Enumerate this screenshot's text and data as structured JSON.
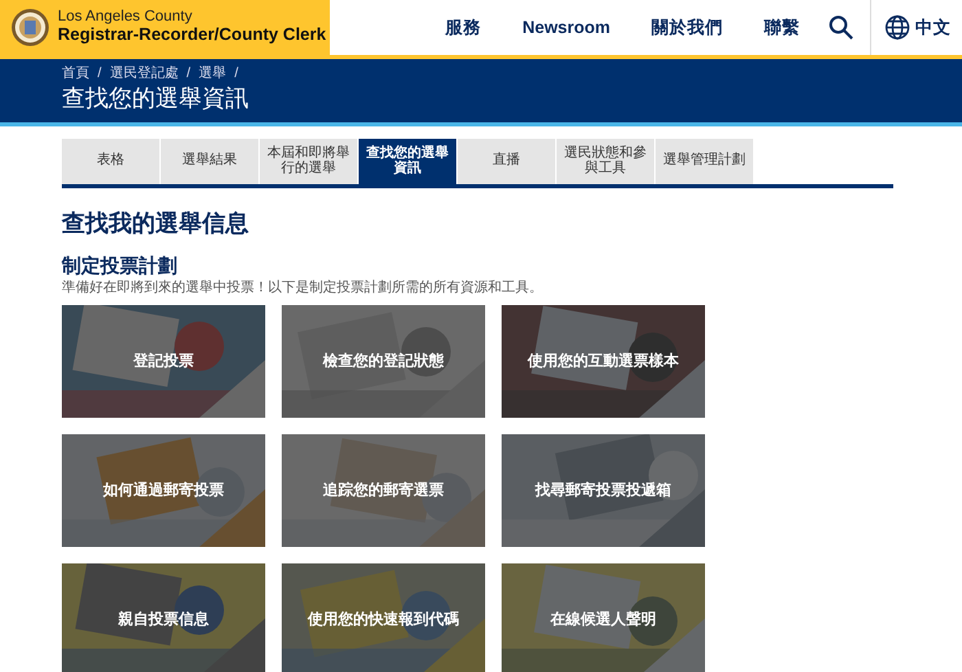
{
  "header": {
    "org_line1": "Los Angeles County",
    "org_line2": "Registrar-Recorder/County Clerk",
    "nav": [
      "服務",
      "Newsroom",
      "關於我們",
      "聯繫"
    ],
    "language": "中文"
  },
  "banner": {
    "breadcrumbs": [
      "首頁",
      "選民登記處",
      "選舉"
    ],
    "separator": "/",
    "title": "查找您的選舉資訊"
  },
  "tabs": [
    {
      "label": "表格",
      "selected": false
    },
    {
      "label": "選舉結果",
      "selected": false
    },
    {
      "label": "本屆和即將舉行的選舉",
      "selected": false
    },
    {
      "label": "查找您的選舉資訊",
      "selected": true
    },
    {
      "label": "直播",
      "selected": false
    },
    {
      "label": "選民狀態和參與工具",
      "selected": false
    },
    {
      "label": "選舉管理計劃",
      "selected": false
    }
  ],
  "page_heading": "查找我的選舉信息",
  "section": {
    "heading": "制定投票計劃",
    "description": "準備好在即將到來的選舉中投票！以下是制定投票計劃所需的所有資源和工具。"
  },
  "tiles": [
    {
      "label": "登記投票"
    },
    {
      "label": "檢查您的登記狀態"
    },
    {
      "label": "使用您的互動選票樣本"
    },
    {
      "label": "如何通過郵寄投票"
    },
    {
      "label": "追踪您的郵寄選票"
    },
    {
      "label": "找尋郵寄投票投遞箱"
    },
    {
      "label": "親自投票信息"
    },
    {
      "label": "使用您的快速報到代碼"
    },
    {
      "label": "在線候選人聲明"
    }
  ]
}
